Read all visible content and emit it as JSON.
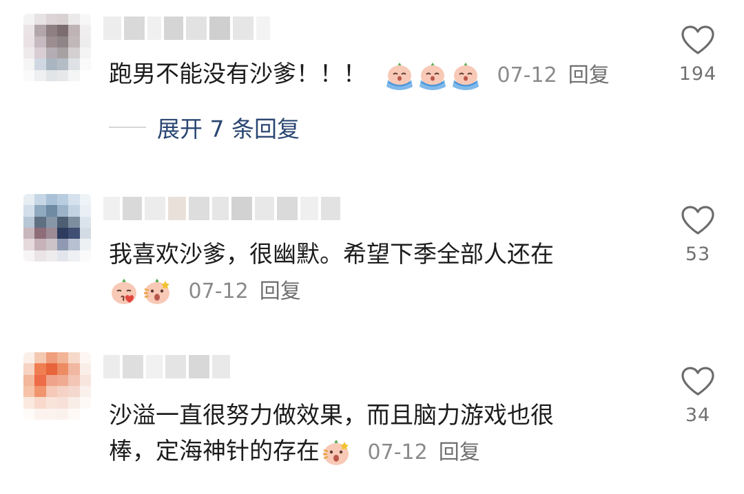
{
  "comments": [
    {
      "text": "跑男不能没有沙爹！！！",
      "date": "07-12",
      "reply_label": "回复",
      "like_count": "194",
      "expand_label": "展开 7 条回复",
      "emojis": [
        "crying-emoji",
        "crying-emoji",
        "crying-emoji"
      ]
    },
    {
      "text": "我喜欢沙爹，很幽默。希望下季全部人还在",
      "date": "07-12",
      "reply_label": "回复",
      "like_count": "53",
      "emojis": [
        "kiss-emoji",
        "shocked-emoji"
      ]
    },
    {
      "text_line1": "沙溢一直很努力做效果，而且脑力游戏也很",
      "text_line2": "棒，定海神针的存在",
      "date": "07-12",
      "reply_label": "回复",
      "like_count": "34",
      "emojis": [
        "shocked-emoji"
      ]
    }
  ],
  "colors": {
    "text": "#1c1c1c",
    "meta": "#8a8a8a",
    "expand": "#2a4672",
    "heart": "#6b6b6b"
  }
}
